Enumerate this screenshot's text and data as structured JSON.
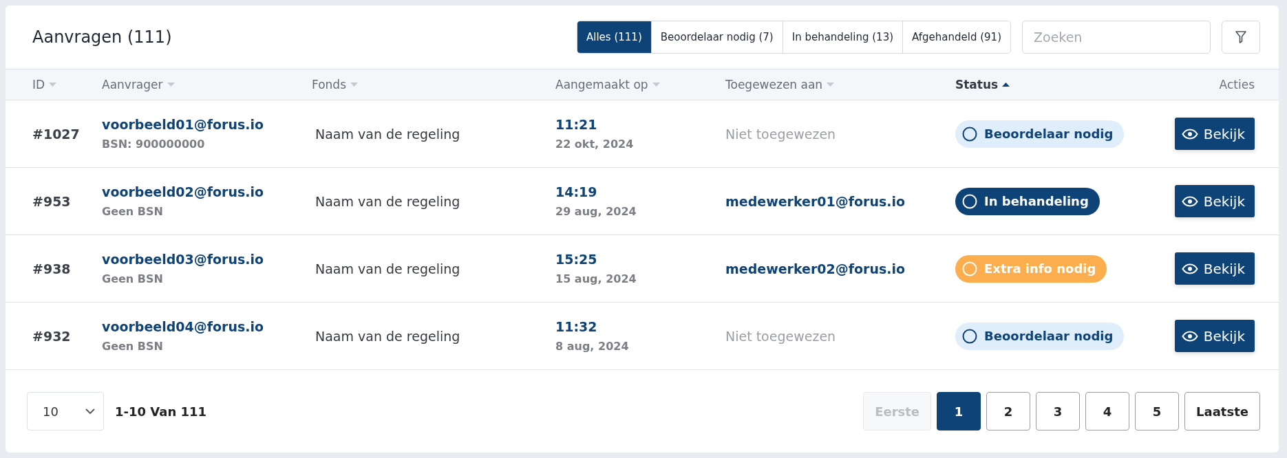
{
  "title": "Aanvragen (111)",
  "filters": [
    {
      "label": "Alles (111)",
      "selected": true
    },
    {
      "label": "Beoordelaar nodig (7)",
      "selected": false
    },
    {
      "label": "In behandeling (13)",
      "selected": false
    },
    {
      "label": "Afgehandeld (91)",
      "selected": false
    }
  ],
  "search": {
    "placeholder": "Zoeken"
  },
  "table": {
    "columns": [
      {
        "label": "ID",
        "sortable": true,
        "sorted": false
      },
      {
        "label": "Aanvrager",
        "sortable": true,
        "sorted": false
      },
      {
        "label": "Fonds",
        "sortable": true,
        "sorted": false
      },
      {
        "label": "Aangemaakt op",
        "sortable": true,
        "sorted": false
      },
      {
        "label": "Toegewezen aan",
        "sortable": true,
        "sorted": false
      },
      {
        "label": "Status",
        "sortable": true,
        "sorted": true
      },
      {
        "label": "Acties",
        "sortable": false,
        "sorted": false
      }
    ],
    "rows": [
      {
        "id": "#1027",
        "email": "voorbeeld01@forus.io",
        "bsn": "BSN: 900000000",
        "fund": "Naam van de regeling",
        "time": "11:21",
        "date": "22 okt, 2024",
        "assignee": "Niet toegewezen",
        "assigned": false,
        "status": {
          "label": "Beoordelaar nodig",
          "kind": "reviewer"
        },
        "action": "Bekijk"
      },
      {
        "id": "#953",
        "email": "voorbeeld02@forus.io",
        "bsn": "Geen BSN",
        "fund": "Naam van de regeling",
        "time": "14:19",
        "date": "29 aug, 2024",
        "assignee": "medewerker01@forus.io",
        "assigned": true,
        "status": {
          "label": "In behandeling",
          "kind": "in_progress"
        },
        "action": "Bekijk"
      },
      {
        "id": "#938",
        "email": "voorbeeld03@forus.io",
        "bsn": "Geen BSN",
        "fund": "Naam van de regeling",
        "time": "15:25",
        "date": "15 aug, 2024",
        "assignee": "medewerker02@forus.io",
        "assigned": true,
        "status": {
          "label": "Extra info nodig",
          "kind": "extra_info"
        },
        "action": "Bekijk"
      },
      {
        "id": "#932",
        "email": "voorbeeld04@forus.io",
        "bsn": "Geen BSN",
        "fund": "Naam van de regeling",
        "time": "11:32",
        "date": "8 aug, 2024",
        "assignee": "Niet toegewezen",
        "assigned": false,
        "status": {
          "label": "Beoordelaar nodig",
          "kind": "reviewer"
        },
        "action": "Bekijk"
      }
    ]
  },
  "footer": {
    "per_page": "10",
    "range": "1-10 Van 111",
    "pages": [
      {
        "label": "Eerste",
        "selected": false,
        "disabled": true
      },
      {
        "label": "1",
        "selected": true,
        "disabled": false
      },
      {
        "label": "2",
        "selected": false,
        "disabled": false
      },
      {
        "label": "3",
        "selected": false,
        "disabled": false
      },
      {
        "label": "4",
        "selected": false,
        "disabled": false
      },
      {
        "label": "5",
        "selected": false,
        "disabled": false
      },
      {
        "label": "Laatste",
        "selected": false,
        "disabled": false
      }
    ]
  }
}
